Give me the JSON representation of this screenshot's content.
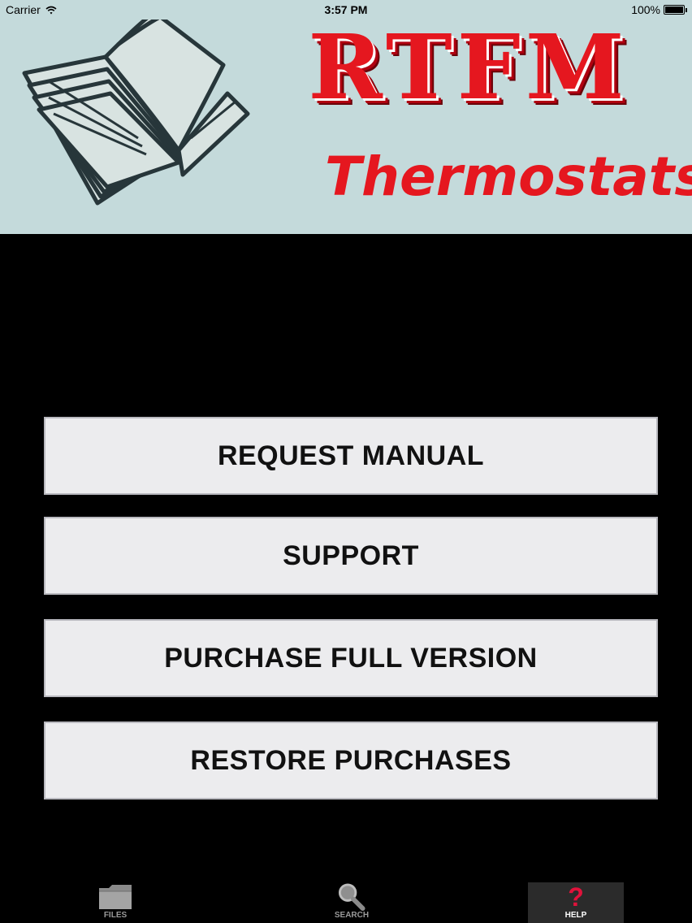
{
  "status_bar": {
    "carrier": "Carrier",
    "time": "3:57 PM",
    "battery": "100%",
    "battery_level": 1.0
  },
  "banner": {
    "title": "RTFM",
    "subtitle": "Thermostats",
    "icon": "open-book-icon",
    "background": "#c4dadb",
    "accent": "#e5171f"
  },
  "menu": {
    "request_manual": "REQUEST MANUAL",
    "support": "SUPPORT",
    "purchase_full": "PURCHASE FULL VERSION",
    "restore": "RESTORE PURCHASES"
  },
  "tabs": {
    "files": {
      "label": "FILES",
      "icon": "folder-icon"
    },
    "search": {
      "label": "SEARCH",
      "icon": "magnifier-icon"
    },
    "help": {
      "label": "HELP",
      "icon": "question-mark-icon",
      "active": true
    }
  }
}
